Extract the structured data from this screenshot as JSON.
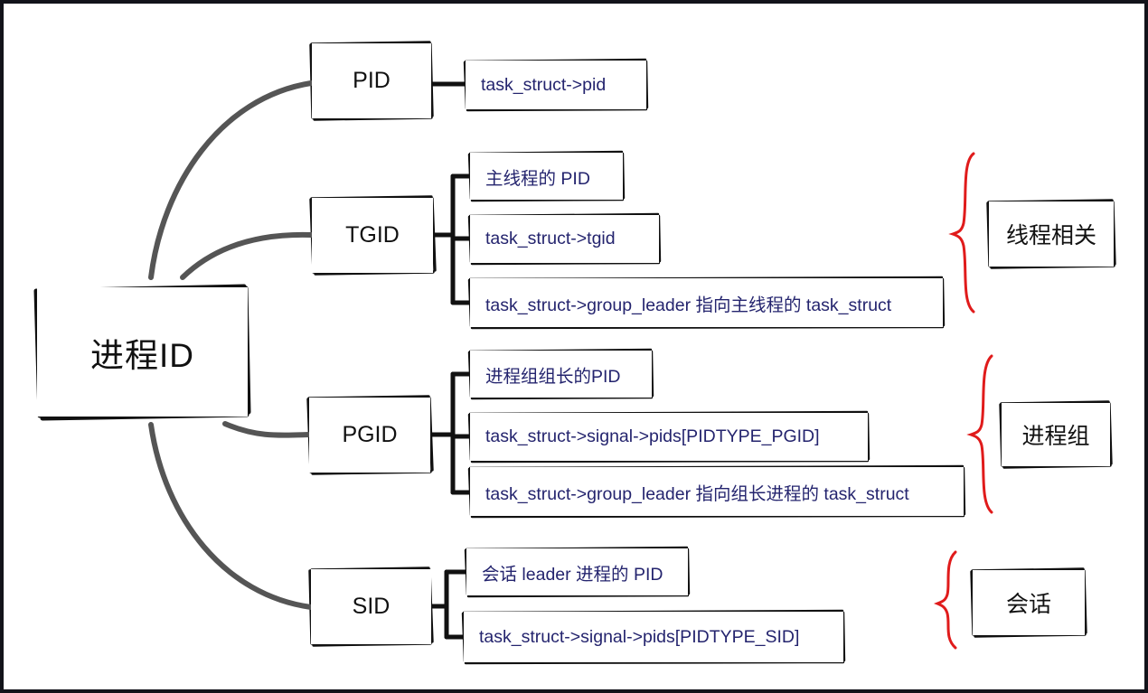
{
  "diagram": {
    "title_node": {
      "label": "进程ID"
    },
    "branches": [
      {
        "id": "pid",
        "label": "PID",
        "details": [
          {
            "text": "task_struct->pid"
          }
        ],
        "group": null
      },
      {
        "id": "tgid",
        "label": "TGID",
        "details": [
          {
            "text": "主线程的 PID"
          },
          {
            "text": "task_struct->tgid"
          },
          {
            "text": "task_struct->group_leader 指向主线程的 task_struct"
          }
        ],
        "group": {
          "label": "线程相关"
        }
      },
      {
        "id": "pgid",
        "label": "PGID",
        "details": [
          {
            "text": "进程组组长的PID"
          },
          {
            "text": "task_struct->signal->pids[PIDTYPE_PGID]"
          },
          {
            "text": "task_struct->group_leader 指向组长进程的 task_struct"
          }
        ],
        "group": {
          "label": "进程组"
        }
      },
      {
        "id": "sid",
        "label": "SID",
        "details": [
          {
            "text": "会话 leader 进程的 PID"
          },
          {
            "text": "task_struct->signal->pids[PIDTYPE_SID]"
          }
        ],
        "group": {
          "label": "会话"
        }
      }
    ],
    "colors": {
      "frame": "#12131a",
      "box_stroke": "#111111",
      "branch_curve": "#555555",
      "connector": "#111111",
      "brace": "#e01b1b",
      "detail_text": "#24246e",
      "node_text": "#111111",
      "background": "#ffffff"
    }
  }
}
